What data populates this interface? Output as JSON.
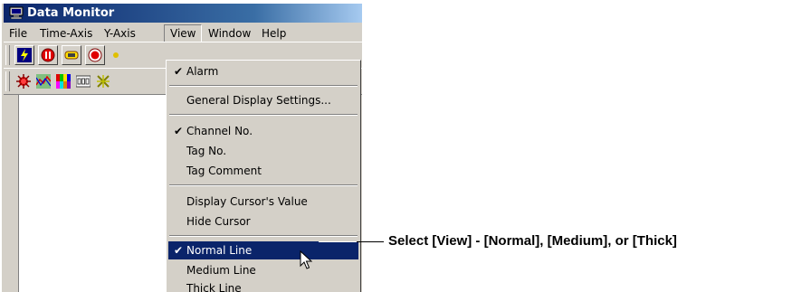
{
  "window": {
    "title": "Data Monitor"
  },
  "menubar": {
    "items": [
      {
        "label": "File"
      },
      {
        "label": "Time-Axis"
      },
      {
        "label": "Y-Axis"
      },
      {
        "label": "View"
      },
      {
        "label": "Window"
      },
      {
        "label": "Help"
      }
    ],
    "active": "View"
  },
  "toolbar1": {
    "buttons": [
      "lightning-icon",
      "stop-icon",
      "link-icon",
      "record-icon"
    ]
  },
  "toolbar2": {
    "buttons": [
      "alarm-icon",
      "trend-icon",
      "color-bars-icon",
      "numeric-999-icon",
      "cross-icon"
    ]
  },
  "view_menu": {
    "check_mark": "✔",
    "items": [
      {
        "label": "Alarm",
        "checked": true
      },
      {
        "label": "General Display Settings..."
      },
      {
        "label": "Channel No.",
        "checked": true
      },
      {
        "label": "Tag No."
      },
      {
        "label": "Tag Comment"
      },
      {
        "label": "Display Cursor's Value"
      },
      {
        "label": "Hide Cursor"
      },
      {
        "label": "Normal Line",
        "checked": true,
        "highlighted": true
      },
      {
        "label": "Medium Line"
      },
      {
        "label": "Thick Line"
      }
    ]
  },
  "annotation": {
    "text": "Select [View] - [Normal], [Medium], or [Thick]"
  },
  "colors": {
    "title_bar": "#0a246a",
    "menu_face": "#d4d0c8",
    "highlight": "#0a246a"
  }
}
